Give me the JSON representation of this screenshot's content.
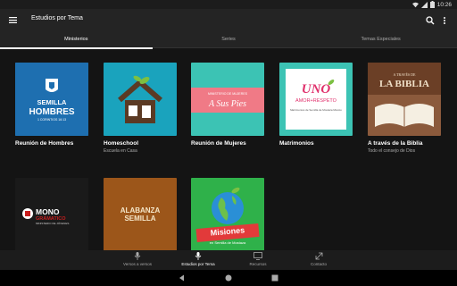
{
  "status": {
    "time": "10:26"
  },
  "appbar": {
    "title": "Estudios por Tema",
    "menu_icon": "hamburger-menu-icon",
    "search_icon": "search-icon",
    "more_icon": "more-vertical-icon"
  },
  "tabs": [
    {
      "label": "Ministerios",
      "active": true
    },
    {
      "label": "Series",
      "active": false
    },
    {
      "label": "Temas Especiales",
      "active": false
    }
  ],
  "cards": [
    {
      "title": "Reunión de Hombres",
      "subtitle": "",
      "art": {
        "top": "SEMILLA",
        "main": "HOMBRES",
        "ref": "1 CORINTIOS 16:13"
      }
    },
    {
      "title": "Homeschool",
      "subtitle": "Escuela en Casa",
      "art": {}
    },
    {
      "title": "Reunión de Mujeres",
      "subtitle": "",
      "art": {
        "small": "MINISTERIO DE MUJERES",
        "main": "A Sus Pies"
      }
    },
    {
      "title": "Matrimonios",
      "subtitle": "",
      "art": {
        "main": "UNO",
        "sub": "AMOR+RESPETO",
        "small": "Matrimonios de Semilla de Mostaza México"
      }
    },
    {
      "title": "A través de la Biblia",
      "subtitle": "Todo el consejo de Dios",
      "art": {
        "small": "A TRAVÉS DE",
        "main": "LA BIBLIA"
      }
    },
    {
      "title": "",
      "subtitle": "",
      "art": {
        "main": "MONO",
        "main2": "GRÁMATICO",
        "small": "MINISTERIO DE JÓVENES"
      }
    },
    {
      "title": "",
      "subtitle": "",
      "art": {
        "main": "ALABANZA",
        "main2": "SEMILLA"
      }
    },
    {
      "title": "",
      "subtitle": "",
      "art": {
        "main": "Misiones",
        "small": "en Semilla de Mostaza"
      }
    }
  ],
  "bottomnav": [
    {
      "label": "Versos a versos",
      "icon": "microphone-icon",
      "active": false
    },
    {
      "label": "Estudios por Tema",
      "icon": "microphone-icon",
      "active": true
    },
    {
      "label": "Recursos",
      "icon": "monitor-icon",
      "active": false
    },
    {
      "label": "Contacto",
      "icon": "contact-icon",
      "active": false
    }
  ]
}
